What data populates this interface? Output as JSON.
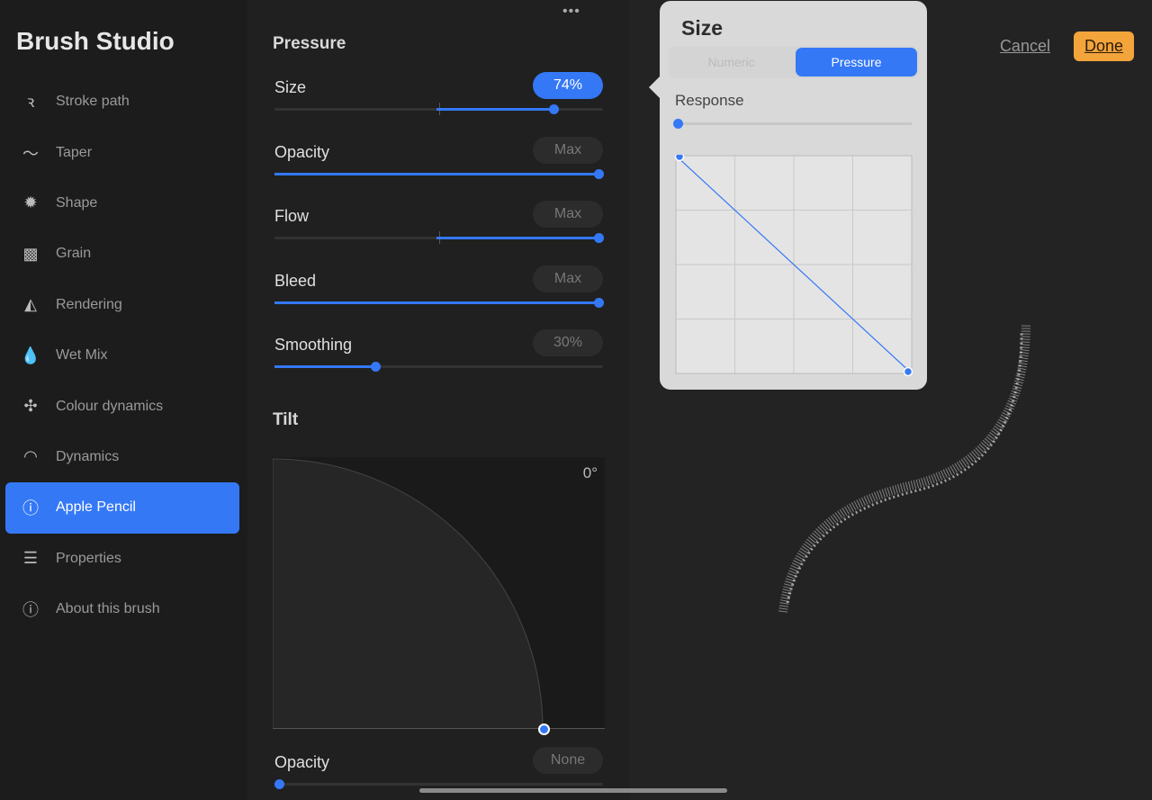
{
  "sidebar": {
    "title": "Brush Studio",
    "items": [
      {
        "label": "Stroke path",
        "icon": "stroke-path-icon"
      },
      {
        "label": "Taper",
        "icon": "taper-icon"
      },
      {
        "label": "Shape",
        "icon": "shape-icon"
      },
      {
        "label": "Grain",
        "icon": "grain-icon"
      },
      {
        "label": "Rendering",
        "icon": "rendering-icon"
      },
      {
        "label": "Wet Mix",
        "icon": "wet-mix-icon"
      },
      {
        "label": "Colour dynamics",
        "icon": "colour-dynamics-icon"
      },
      {
        "label": "Dynamics",
        "icon": "dynamics-icon"
      },
      {
        "label": "Apple Pencil",
        "icon": "apple-pencil-icon"
      },
      {
        "label": "Properties",
        "icon": "properties-icon"
      },
      {
        "label": "About this brush",
        "icon": "info-icon"
      }
    ],
    "active": "Apple Pencil"
  },
  "pressure": {
    "heading": "Pressure",
    "sliders": [
      {
        "label": "Size",
        "value": "74%",
        "fraction": 0.86,
        "centered": true,
        "highlight": true
      },
      {
        "label": "Opacity",
        "value": "Max",
        "fraction": 1,
        "centered": false
      },
      {
        "label": "Flow",
        "value": "Max",
        "fraction": 1,
        "centered": true
      },
      {
        "label": "Bleed",
        "value": "Max",
        "fraction": 1,
        "centered": false
      },
      {
        "label": "Smoothing",
        "value": "30%",
        "fraction": 0.31,
        "centered": false
      }
    ]
  },
  "tilt": {
    "heading": "Tilt",
    "angle": "0°",
    "opacity_label": "Opacity",
    "opacity_value": "None",
    "opacity_fraction": 0
  },
  "toolbar": {
    "cancel": "Cancel",
    "done": "Done"
  },
  "popover": {
    "title": "Size",
    "segments": [
      "Numeric",
      "Pressure"
    ],
    "selected": "Pressure",
    "response_label": "Response",
    "response_fraction": 0,
    "curve": [
      [
        0,
        1
      ],
      [
        1,
        0
      ]
    ]
  },
  "colors": {
    "accent": "#3478f6",
    "done": "#f3a43b"
  }
}
